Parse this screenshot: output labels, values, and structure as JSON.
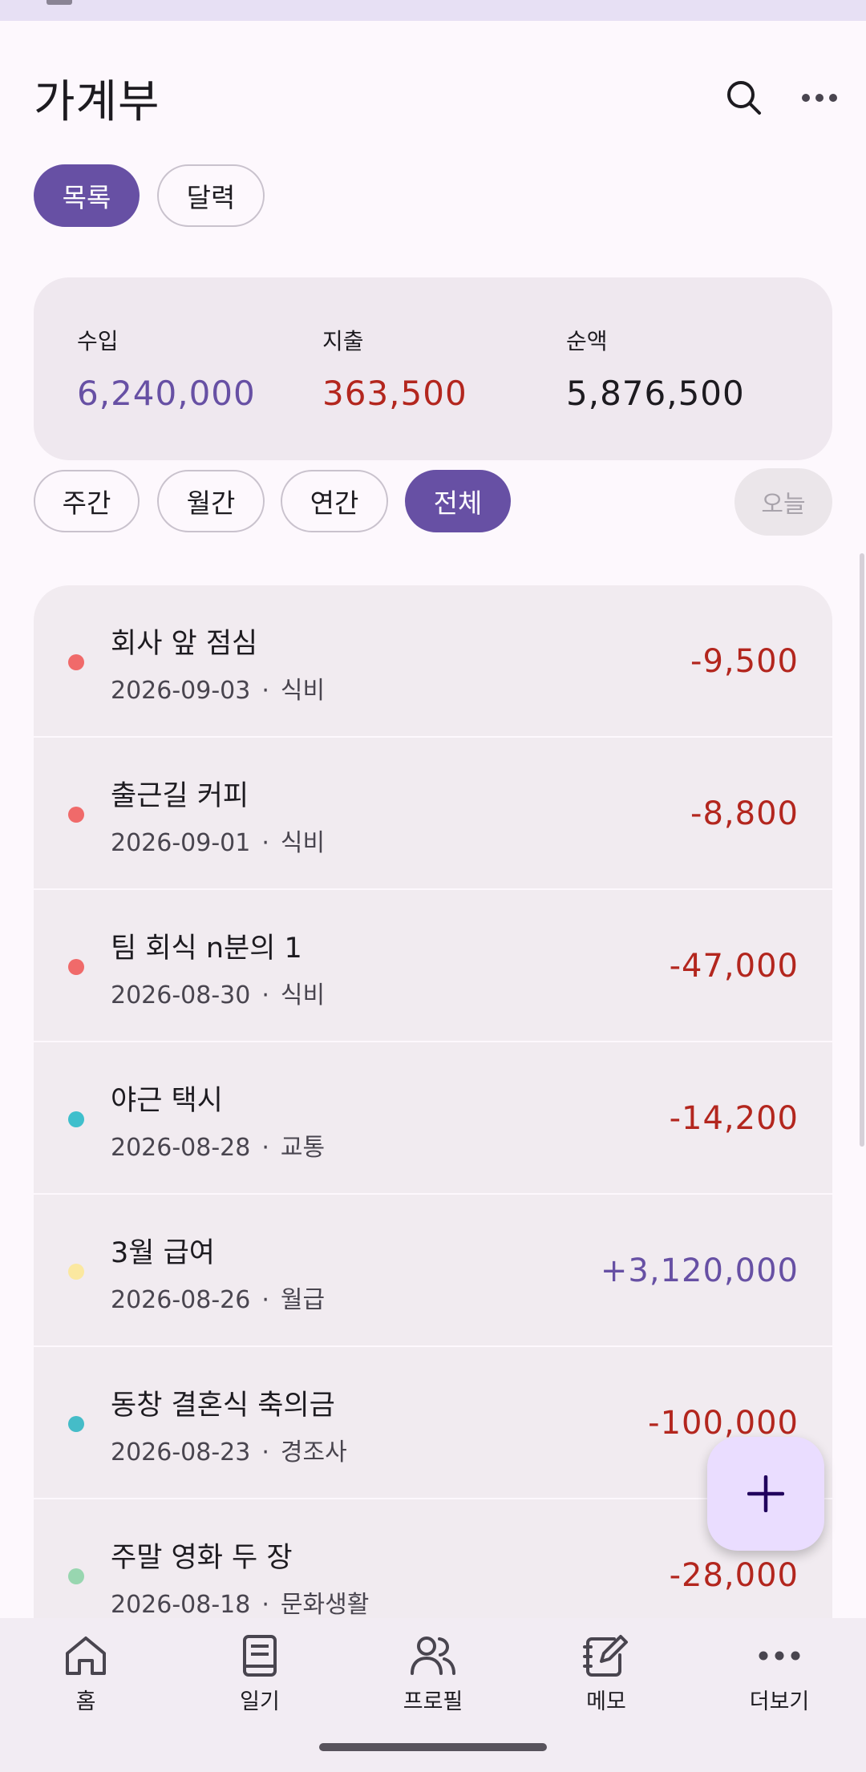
{
  "header": {
    "title": "가계부",
    "search_icon": "search-icon",
    "more_icon": "more-horiz-icon"
  },
  "view_tabs": [
    {
      "label": "목록",
      "selected": true
    },
    {
      "label": "달력",
      "selected": false
    }
  ],
  "summary": {
    "income_label": "수입",
    "income_value": "6,240,000",
    "expense_label": "지출",
    "expense_value": "363,500",
    "net_label": "순액",
    "net_value": "5,876,500"
  },
  "period_filters": [
    {
      "label": "주간",
      "selected": false
    },
    {
      "label": "월간",
      "selected": false
    },
    {
      "label": "연간",
      "selected": false
    },
    {
      "label": "전체",
      "selected": true
    }
  ],
  "today_button": "오늘",
  "transactions": [
    {
      "title": "회사 앞 점심",
      "date": "2026-09-03",
      "category": "식비",
      "amount": "-9,500",
      "dot_color": "#f06a6a",
      "amount_color": "#b3261e"
    },
    {
      "title": "출근길 커피",
      "date": "2026-09-01",
      "category": "식비",
      "amount": "-8,800",
      "dot_color": "#f06a6a",
      "amount_color": "#b3261e"
    },
    {
      "title": "팀 회식 n분의 1",
      "date": "2026-08-30",
      "category": "식비",
      "amount": "-47,000",
      "dot_color": "#f06a6a",
      "amount_color": "#b3261e"
    },
    {
      "title": "야근 택시",
      "date": "2026-08-28",
      "category": "교통",
      "amount": "-14,200",
      "dot_color": "#3fbfcc",
      "amount_color": "#b3261e"
    },
    {
      "title": "3월 급여",
      "date": "2026-08-26",
      "category": "월급",
      "amount": "+3,120,000",
      "dot_color": "#fbe8a0",
      "amount_color": "#6750a4"
    },
    {
      "title": "동창 결혼식 축의금",
      "date": "2026-08-23",
      "category": "경조사",
      "amount": "-100,000",
      "dot_color": "#45bcc8",
      "amount_color": "#b3261e"
    },
    {
      "title": "주말 영화 두 장",
      "date": "2026-08-18",
      "category": "문화생활",
      "amount": "-28,000",
      "dot_color": "#98d6b0",
      "amount_color": "#b3261e"
    }
  ],
  "meta_separator": "·",
  "fab": {
    "icon": "add-icon"
  },
  "bottom_nav": [
    {
      "label": "홈",
      "icon": "home-icon"
    },
    {
      "label": "일기",
      "icon": "book-icon"
    },
    {
      "label": "프로필",
      "icon": "people-icon"
    },
    {
      "label": "메모",
      "icon": "note-edit-icon"
    },
    {
      "label": "더보기",
      "icon": "more-horiz-icon"
    }
  ],
  "colors": {
    "accent": "#6750a4",
    "expense": "#b3261e",
    "fab_bg": "#eaddff"
  }
}
